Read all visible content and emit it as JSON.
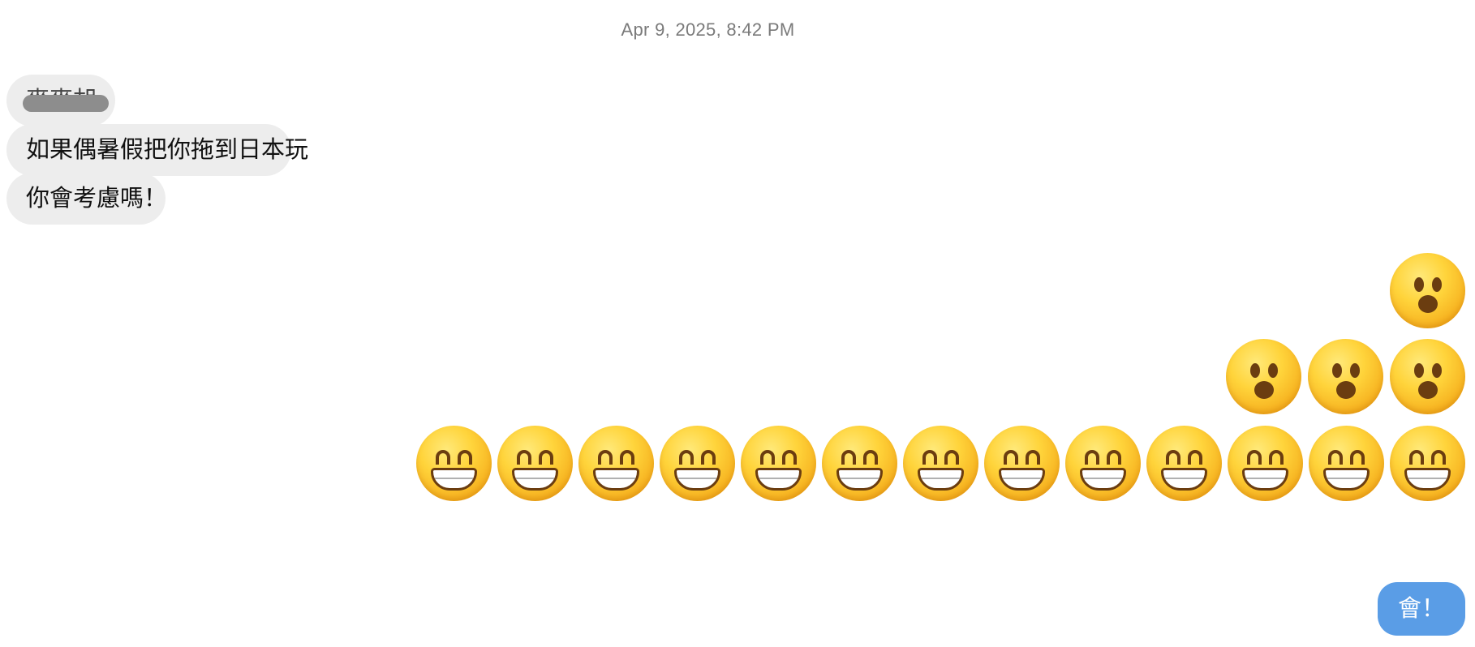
{
  "timestamp": "Apr 9, 2025, 8:42 PM",
  "received_messages": [
    {
      "text": "麥麥胡"
    },
    {
      "text": "如果偶暑假把你拖到日本玩"
    },
    {
      "text": "你會考慮嗎！"
    }
  ],
  "sent_reactions": {
    "row1": {
      "emoji": "hushed-face",
      "count": 1
    },
    "row2": {
      "emoji": "hushed-face",
      "count": 3
    },
    "row3": {
      "emoji": "grinning-face-with-smiling-eyes",
      "count": 13
    }
  },
  "sent_message": {
    "text": "會！"
  },
  "colors": {
    "received_bubble": "#ededed",
    "sent_bubble": "#5a9de6"
  }
}
